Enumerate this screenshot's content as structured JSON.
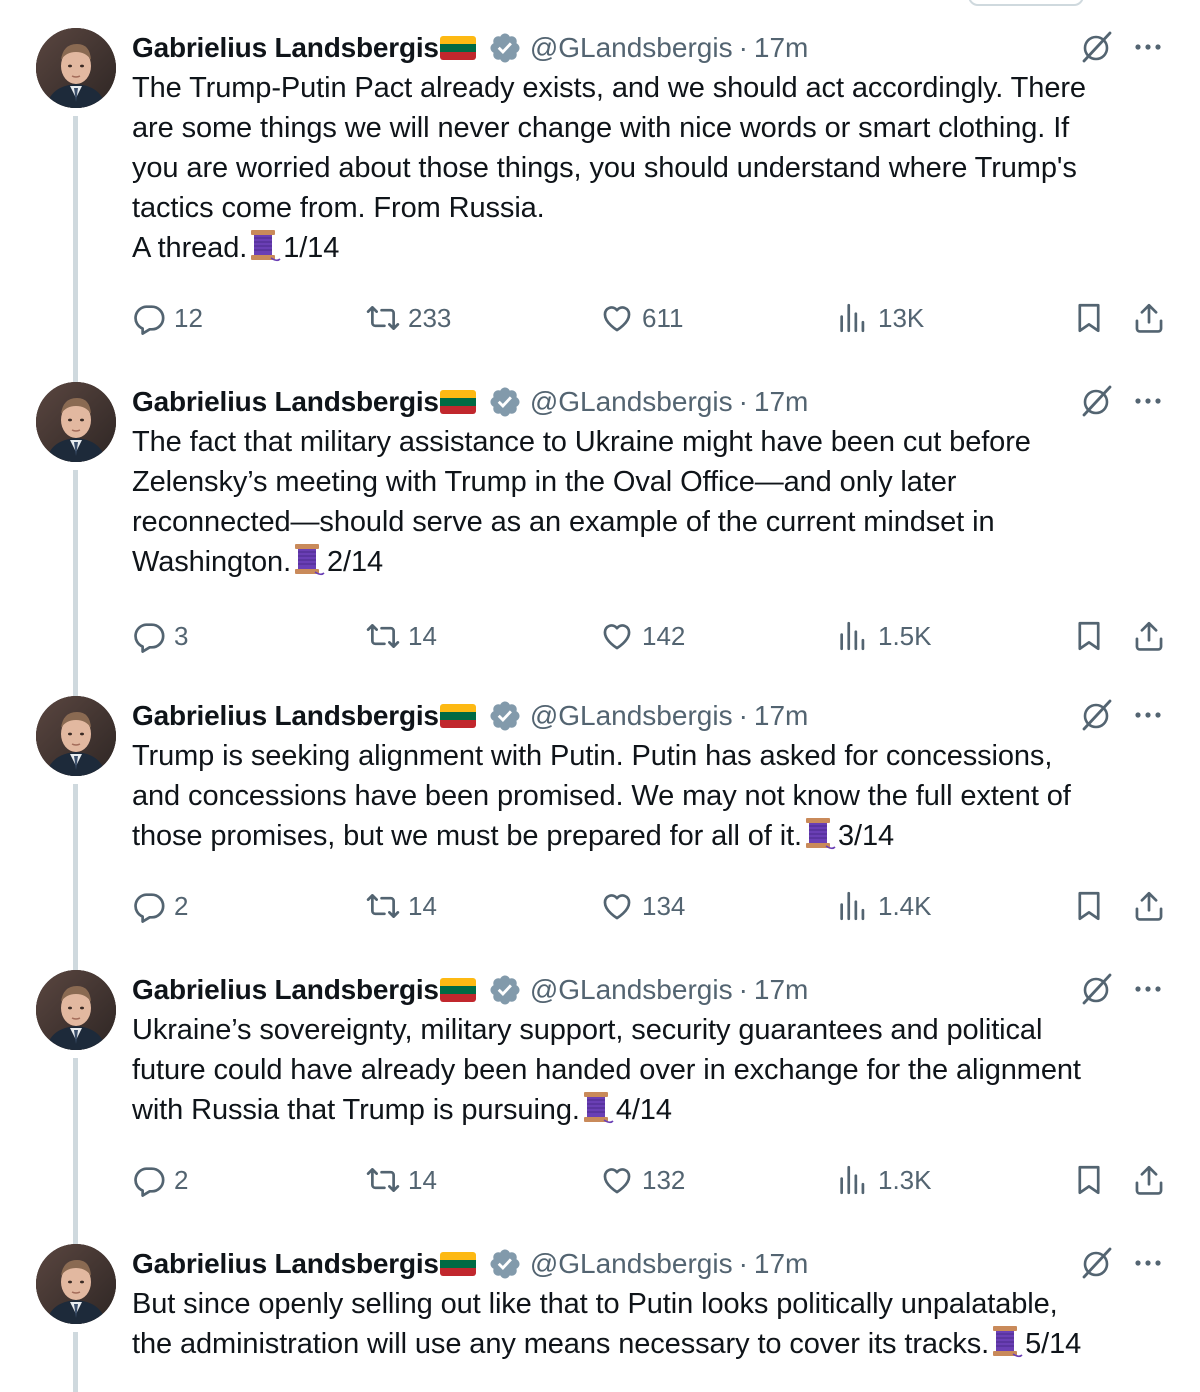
{
  "tweets": [
    {
      "author": {
        "name": "Gabrielius Landsbergis",
        "handle": "@GLandsbergis",
        "time": "17m",
        "flag": "LT",
        "verified": true
      },
      "lines": [
        {
          "text": "The Trump-Putin Pact already exists, and we should act accordingly. There"
        },
        {
          "text": "are some things we will never change with nice words or smart clothing. If"
        },
        {
          "text": "you are worried about those things, you should understand where Trump's"
        },
        {
          "text": "tactics come from. From Russia."
        },
        {
          "text": "A thread.",
          "spool": true,
          "after": "1/14"
        }
      ],
      "stats": {
        "replies": "12",
        "reposts": "233",
        "likes": "611",
        "views": "13K"
      }
    },
    {
      "author": {
        "name": "Gabrielius Landsbergis",
        "handle": "@GLandsbergis",
        "time": "17m",
        "flag": "LT",
        "verified": true
      },
      "lines": [
        {
          "text": "The fact that military assistance to Ukraine might have been cut before"
        },
        {
          "text": "Zelensky’s meeting with Trump in the Oval Office—and only later"
        },
        {
          "text": "reconnected—should serve as an example of the current mindset in"
        },
        {
          "text": "Washington.",
          "spool": true,
          "after": "2/14"
        }
      ],
      "stats": {
        "replies": "3",
        "reposts": "14",
        "likes": "142",
        "views": "1.5K"
      }
    },
    {
      "author": {
        "name": "Gabrielius Landsbergis",
        "handle": "@GLandsbergis",
        "time": "17m",
        "flag": "LT",
        "verified": true
      },
      "lines": [
        {
          "text": "Trump is seeking alignment with Putin. Putin has asked for concessions,"
        },
        {
          "text": "and concessions have been promised. We may not know the full extent of"
        },
        {
          "text": "those promises, but we must be prepared for all of it.",
          "spool": true,
          "after": "3/14"
        }
      ],
      "stats": {
        "replies": "2",
        "reposts": "14",
        "likes": "134",
        "views": "1.4K"
      }
    },
    {
      "author": {
        "name": "Gabrielius Landsbergis",
        "handle": "@GLandsbergis",
        "time": "17m",
        "flag": "LT",
        "verified": true
      },
      "lines": [
        {
          "text": "Ukraine’s sovereignty, military support, security guarantees and political"
        },
        {
          "text": "future could have already been handed over in exchange for the alignment"
        },
        {
          "text": "with Russia that Trump is pursuing.",
          "spool": true,
          "after": "4/14"
        }
      ],
      "stats": {
        "replies": "2",
        "reposts": "14",
        "likes": "132",
        "views": "1.3K"
      }
    },
    {
      "author": {
        "name": "Gabrielius Landsbergis",
        "handle": "@GLandsbergis",
        "time": "17m",
        "flag": "LT",
        "verified": true
      },
      "lines": [
        {
          "text": "But since openly selling out like that to Putin looks politically unpalatable,"
        },
        {
          "text": "the administration will use any means necessary to cover its tracks.",
          "spool": true,
          "after": "5/14"
        }
      ],
      "stats": null
    }
  ],
  "icons": {
    "reply": "reply-icon",
    "repost": "repost-icon",
    "like": "heart-icon",
    "views": "views-icon",
    "bookmark": "bookmark-icon",
    "share": "share-icon",
    "grok": "grok-icon",
    "more": "more-icon",
    "verified": "verified-badge-icon",
    "thread": "spool-of-thread-icon"
  },
  "colors": {
    "text": "#0f1419",
    "secondary": "#536471",
    "verified": "#829aab",
    "thread_line": "#cfd9de",
    "flag_yellow": "#fdb913",
    "flag_green": "#006a44",
    "flag_red": "#c1272d",
    "spool_purple": "#6a3fb5"
  }
}
